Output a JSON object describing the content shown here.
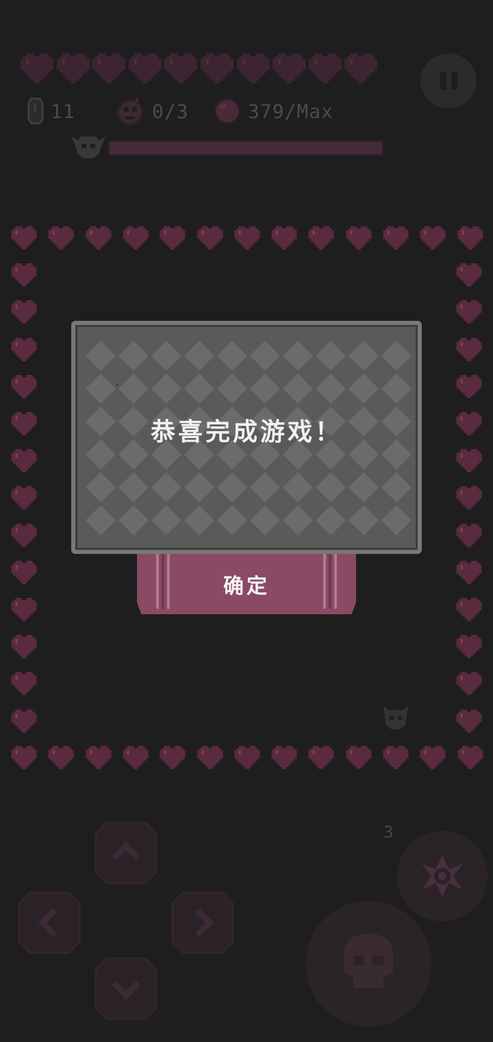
{
  "hud": {
    "hearts_count": 10,
    "gems": "11",
    "bombs": "0/3",
    "coins": "379/Max",
    "boss_health": 1.0
  },
  "dialog": {
    "message": "恭喜完成游戏！",
    "confirm_label": "确定"
  },
  "controls": {
    "skill_count": "3"
  },
  "colors": {
    "background": "#1f1e1f",
    "heart": "#5a2a3e",
    "dialog_frame": "#787878",
    "dialog_panel": "#5a5a5a",
    "confirm_button": "#8a4a66",
    "boss_bar": "#442b39"
  },
  "icons": {
    "pause": "pause-icon",
    "gem": "gem-icon",
    "bomb": "bomb-icon",
    "coin": "coin-icon",
    "boss": "boss-skull-icon",
    "up": "arrow-up-icon",
    "down": "arrow-down-icon",
    "left": "arrow-left-icon",
    "right": "arrow-right-icon",
    "skill": "shuriken-icon",
    "attack": "skull-attack-icon"
  }
}
